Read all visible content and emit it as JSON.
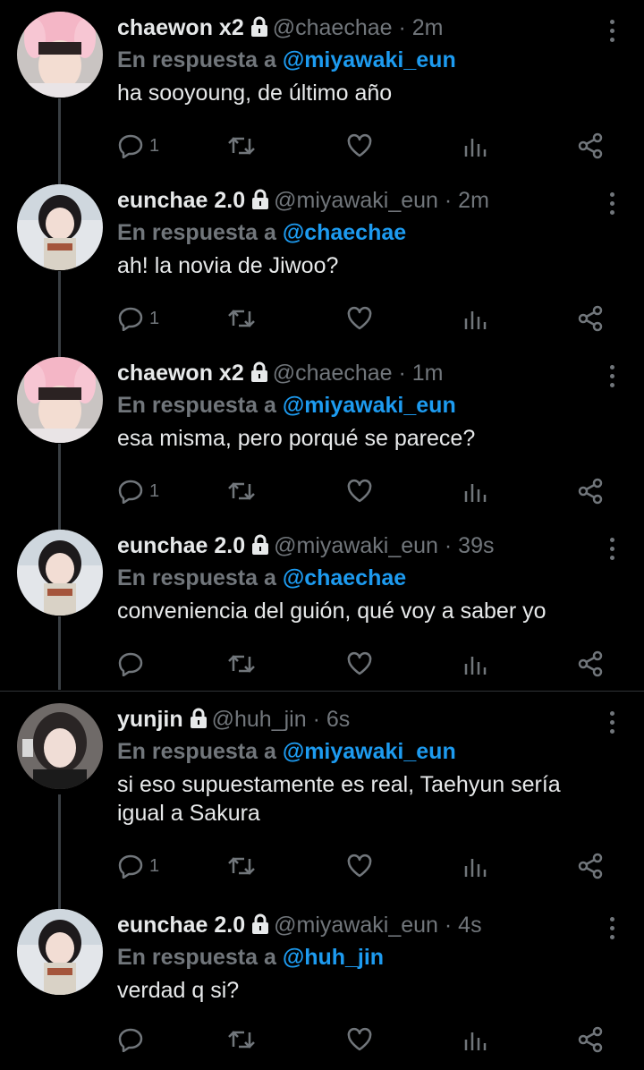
{
  "reply_prefix": "En respuesta a",
  "tweets": [
    {
      "name": "chaewon x2",
      "handle": "@chaechae",
      "sep": "·",
      "time": "2m",
      "reply_to": "@miyawaki_eun",
      "text": "ha sooyoung, de último año",
      "reply_count": "1",
      "avatar": "chaewon-avatar"
    },
    {
      "name": "eunchae 2.0",
      "handle": "@miyawaki_eun",
      "sep": "·",
      "time": "2m",
      "reply_to": "@chaechae",
      "text": "ah! la novia de Jiwoo?",
      "reply_count": "1",
      "avatar": "eunchae-avatar"
    },
    {
      "name": "chaewon x2",
      "handle": "@chaechae",
      "sep": "·",
      "time": "1m",
      "reply_to": "@miyawaki_eun",
      "text": "esa misma, pero porqué se parece?",
      "reply_count": "1",
      "avatar": "chaewon-avatar"
    },
    {
      "name": "eunchae 2.0",
      "handle": "@miyawaki_eun",
      "sep": "·",
      "time": "39s",
      "reply_to": "@chaechae",
      "text": "conveniencia del guión, qué voy a saber yo",
      "reply_count": "",
      "avatar": "eunchae-avatar"
    },
    {
      "name": "yunjin",
      "handle": "@huh_jin",
      "sep": "·",
      "time": "6s",
      "reply_to": "@miyawaki_eun",
      "text": "si eso supuestamente es real, Taehyun sería igual a Sakura",
      "reply_count": "1",
      "avatar": "yunjin-avatar"
    },
    {
      "name": "eunchae 2.0",
      "handle": "@miyawaki_eun",
      "sep": "·",
      "time": "4s",
      "reply_to": "@huh_jin",
      "text": "verdad q si?",
      "reply_count": "",
      "avatar": "eunchae-avatar"
    }
  ],
  "colors": {
    "background": "#000000",
    "text": "#e7e9ea",
    "muted": "#71767b",
    "link": "#1d9bf0",
    "thread_line": "#3a3f44"
  }
}
